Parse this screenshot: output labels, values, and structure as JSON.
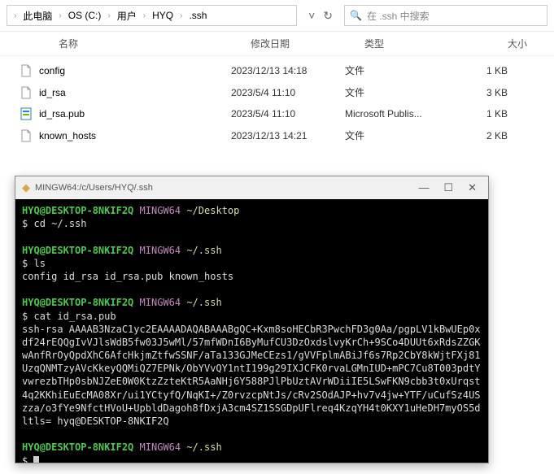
{
  "breadcrumb": [
    "此电脑",
    "OS (C:)",
    "用户",
    "HYQ",
    ".ssh"
  ],
  "search": {
    "placeholder": "在 .ssh 中搜索"
  },
  "columns": {
    "name": "名称",
    "date": "修改日期",
    "type": "类型",
    "size": "大小"
  },
  "files": [
    {
      "icon": "file",
      "name": "config",
      "date": "2023/12/13 14:18",
      "type": "文件",
      "size": "1 KB"
    },
    {
      "icon": "file",
      "name": "id_rsa",
      "date": "2023/5/4 11:10",
      "type": "文件",
      "size": "3 KB"
    },
    {
      "icon": "pub",
      "name": "id_rsa.pub",
      "date": "2023/5/4 11:10",
      "type": "Microsoft Publis...",
      "size": "1 KB"
    },
    {
      "icon": "file",
      "name": "known_hosts",
      "date": "2023/12/13 14:21",
      "type": "文件",
      "size": "2 KB"
    }
  ],
  "terminal": {
    "title": "MINGW64:/c/Users/HYQ/.ssh",
    "user_host": "HYQ@DESKTOP-8NKIF2Q",
    "env": "MINGW64",
    "paths": {
      "desktop": "~/Desktop",
      "ssh": "~/.ssh"
    },
    "cmd_cd": "cd ~/.ssh",
    "cmd_ls": "ls",
    "ls_output": "config  id_rsa  id_rsa.pub  known_hosts",
    "cmd_cat": "cat id_rsa.pub",
    "key_output": "ssh-rsa AAAAB3NzaC1yc2EAAAADAQABAAABgQC+Kxm8soHECbR3PwchFD3g0Aa/pgpLV1kBwUEp0xdf24rEQQgIvVJlsWdB5fw03J5wMl/57mfWDnI6ByMufCU3DzOxdslvyKrCh+9SCo4DUUt6xRdsZZGKwAnfRrOyQpdXhC6AfcHkjmZtfwSSNF/aTa133GJMeCEzs1/gVVFplmABiJf6s7Rp2CbY8kWjtFXj81UzqQNMTzyAVcKkeyQQMiQZ7EPNk/ObYVvQY1ntI199g29IXJCFK0rvaLGMnIUD+mPC7Cu8T003pdtYvwrezbTHp0sbNJZeE0W0KtzZzteKtR5AaNHj6Y588PJlPbUztAVrWDiiIE5LSwFKN9cbb3t0xUrqst4q2KKhiEuEcMA08Xr/ui1YCtyfQ/NqKI+/Z0rvzcpNtJs/cRv2SOdAJP+hv7v4jw+YTF/uCufSz4USzza/o3fYe9NfctHVoU+UpbldDagoh8fDxjA3cm4SZ1SSGDpUFlreq4KzqYH4t0KXY1uHeDH7myOS5dltls= hyq@DESKTOP-8NKIF2Q",
    "dollar": "$"
  }
}
